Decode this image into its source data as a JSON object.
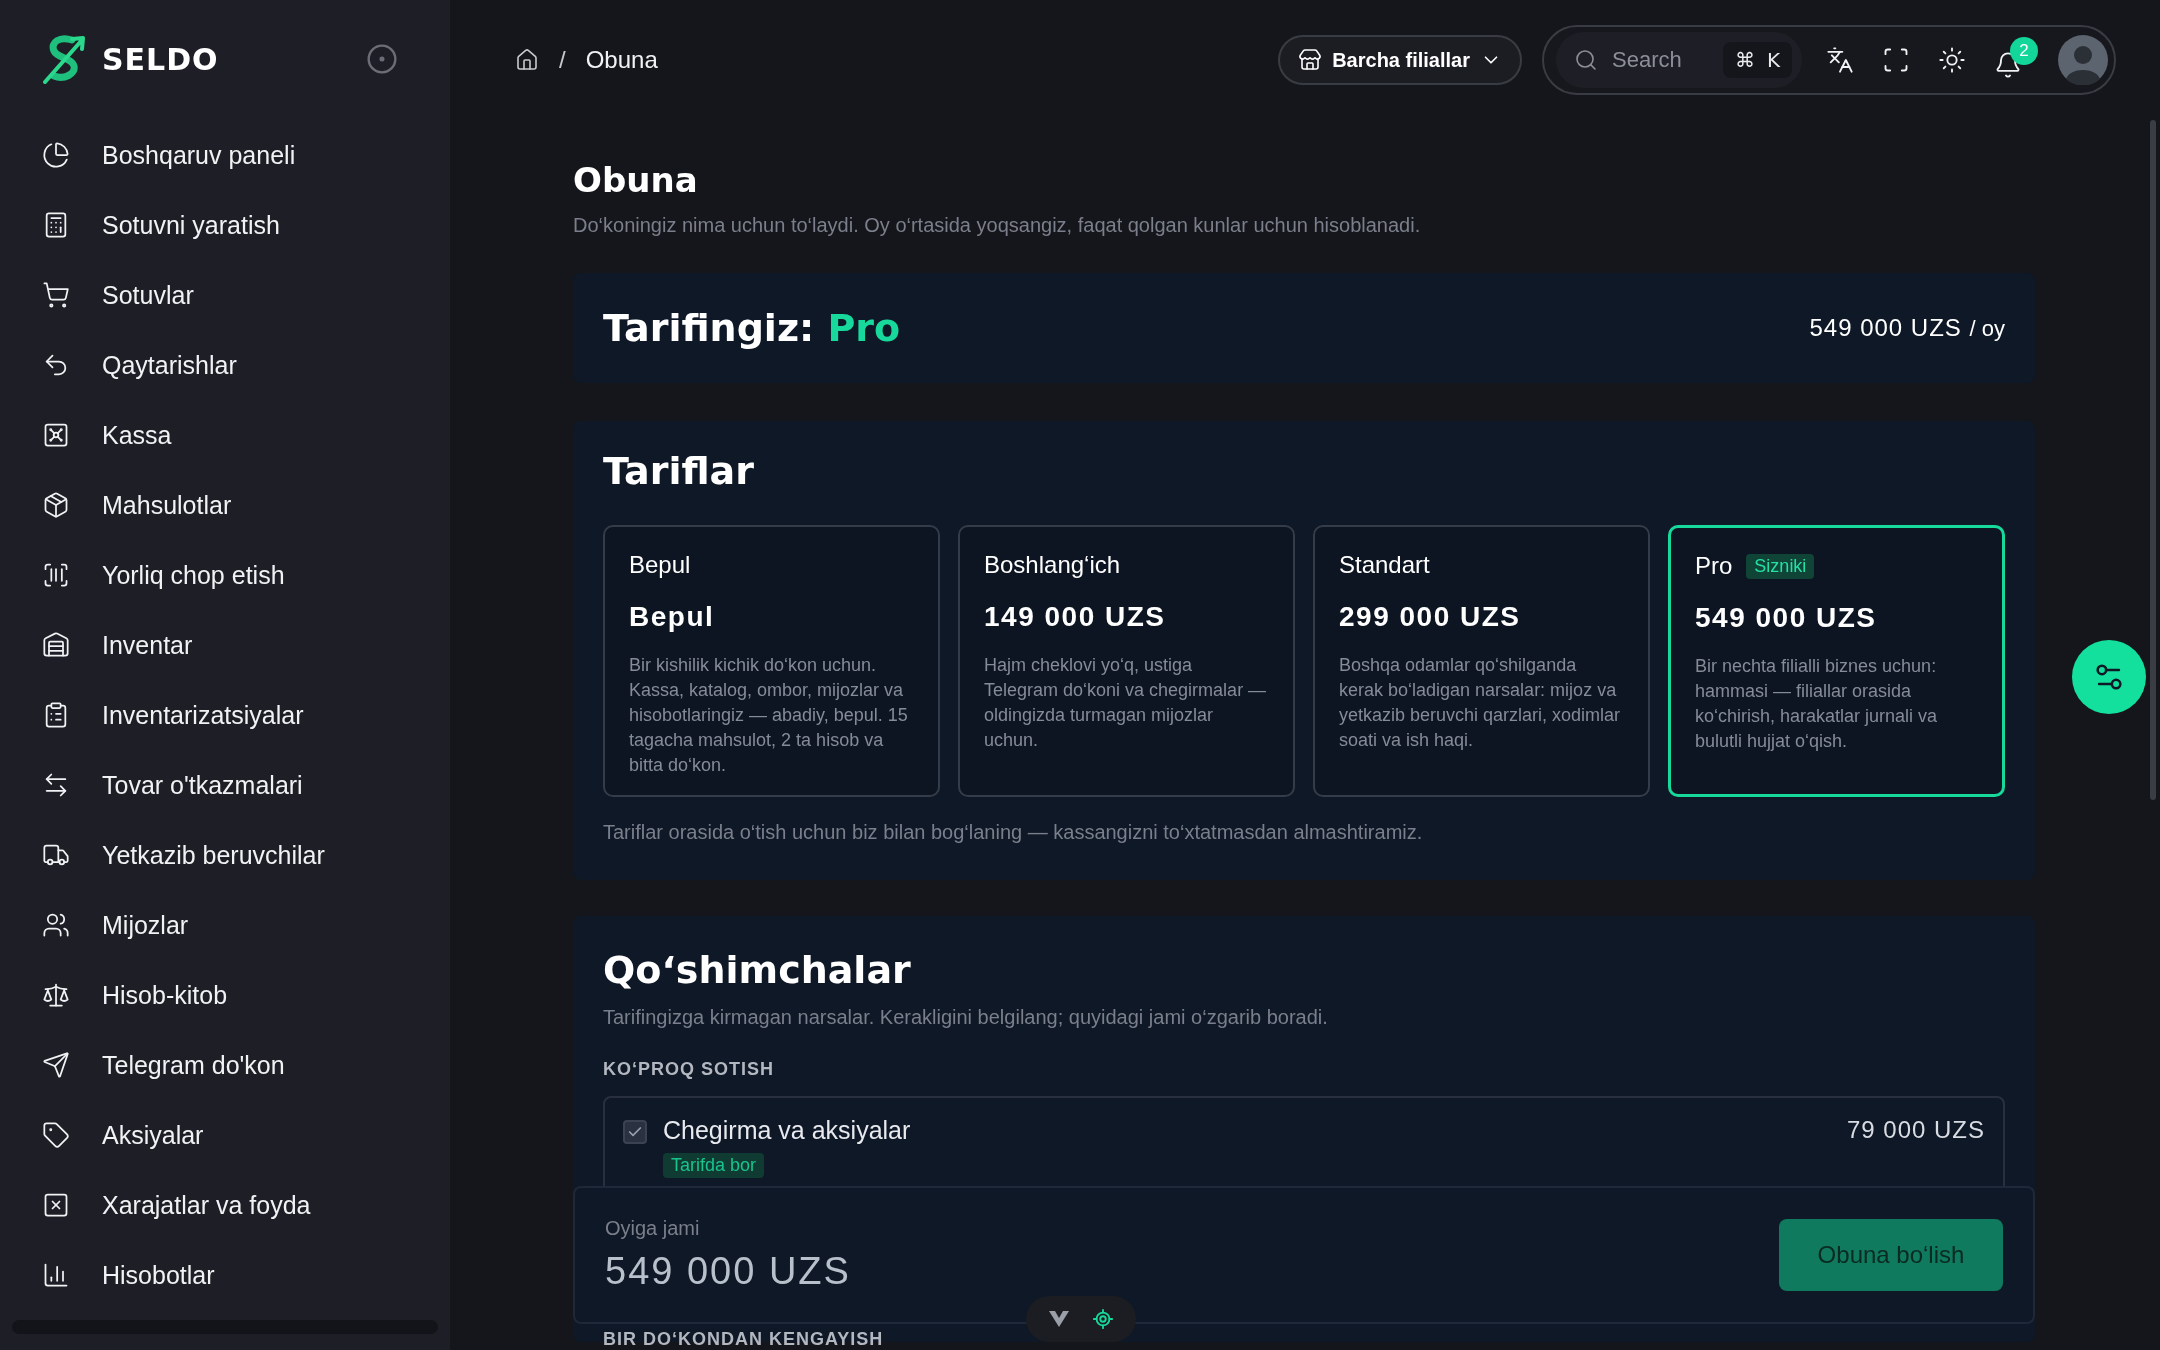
{
  "sidebar": {
    "logo": "SELDO",
    "items": [
      {
        "label": "Boshqaruv paneli"
      },
      {
        "label": "Sotuvni yaratish"
      },
      {
        "label": "Sotuvlar"
      },
      {
        "label": "Qaytarishlar"
      },
      {
        "label": "Kassa"
      },
      {
        "label": "Mahsulotlar"
      },
      {
        "label": "Yorliq chop etish"
      },
      {
        "label": "Inventar"
      },
      {
        "label": "Inventarizatsiyalar"
      },
      {
        "label": "Tovar o'tkazmalari"
      },
      {
        "label": "Yetkazib beruvchilar"
      },
      {
        "label": "Mijozlar"
      },
      {
        "label": "Hisob-kitob"
      },
      {
        "label": "Telegram do'kon"
      },
      {
        "label": "Aksiyalar"
      },
      {
        "label": "Xarajatlar va foyda"
      },
      {
        "label": "Hisobotlar"
      }
    ]
  },
  "breadcrumb": {
    "separator": "/",
    "current": "Obuna"
  },
  "header": {
    "branch": "Barcha filiallar",
    "search": {
      "placeholder": "Search",
      "shortcut_keys": [
        "⌘",
        "K"
      ]
    },
    "notifications": "2"
  },
  "page": {
    "title": "Obuna",
    "subtitle": "Do‘koningiz nima uchun to‘laydi. Oy o‘rtasida yoqsangiz, faqat qolgan kunlar uchun hisoblanadi."
  },
  "current_plan": {
    "label": "Tarifingiz:",
    "plan": "Pro",
    "price": "549 000 UZS",
    "period": "/ oy"
  },
  "plans": {
    "title": "Tariflar",
    "items": [
      {
        "name": "Bepul",
        "price": "Bepul",
        "description": "Bir kishilik kichik do‘kon uchun. Kassa, katalog, ombor, mijozlar va hisobotlaringiz — abadiy, bepul. 15 tagacha mahsulot, 2 ta hisob va bitta do‘kon.",
        "selected": false
      },
      {
        "name": "Boshlang‘ich",
        "price": "149 000 UZS",
        "description": "Hajm cheklovi yo‘q, ustiga Telegram do‘koni va chegirmalar — oldingizda turmagan mijozlar uchun.",
        "selected": false
      },
      {
        "name": "Standart",
        "price": "299 000 UZS",
        "description": "Boshqa odamlar qo‘shilganda kerak bo‘ladigan narsalar: mijoz va yetkazib beruvchi qarzlari, xodimlar soati va ish haqi.",
        "selected": false
      },
      {
        "name": "Pro",
        "badge": "Sizniki",
        "price": "549 000 UZS",
        "description": "Bir nechta filialli biznes uchun: hammasi — filiallar orasida ko‘chirish, harakatlar jurnali va bulutli hujjat o‘qish.",
        "selected": true
      }
    ],
    "note": "Tariflar orasida o‘tish uchun biz bilan bog‘laning — kassangizni to‘xtatmasdan almashtiramiz."
  },
  "addons": {
    "title": "Qo‘shimchalar",
    "subtitle": "Tarifingizga kirmagan narsalar. Kerakligini belgilang; quyidagi jami o‘zgarib boradi.",
    "sections": [
      {
        "heading": "KO‘PROQ SOTISH",
        "items": [
          {
            "name": "Chegirma va aksiyalar",
            "price": "79 000 UZS",
            "checked": true,
            "tag": "Tarifda bor"
          }
        ]
      },
      {
        "heading": "BIR DO‘KONDAN KENGAYISH"
      }
    ]
  },
  "footer": {
    "label": "Oyiga jami",
    "total": "549 000 UZS",
    "button": "Obuna bo‘lish"
  }
}
